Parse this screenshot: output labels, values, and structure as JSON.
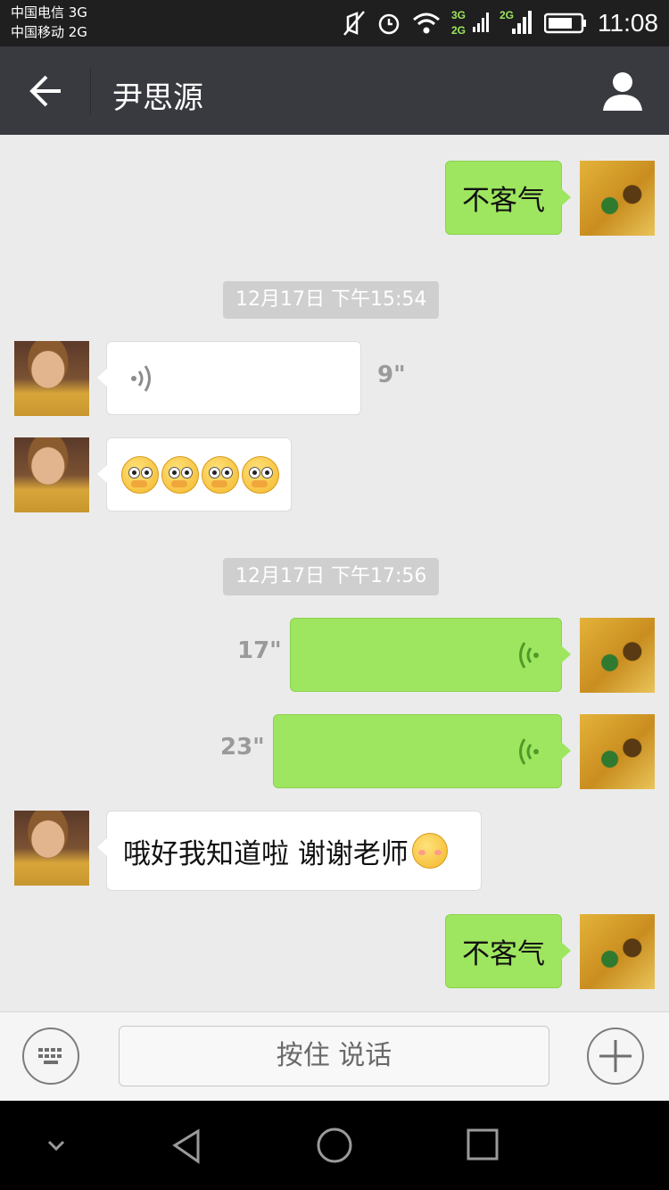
{
  "status_bar": {
    "carrier_1": "中国电信 3G",
    "carrier_2": "中国移动 2G",
    "time": "11:08",
    "net_1": "3G",
    "net_2": "2G",
    "net_3": "2G"
  },
  "header": {
    "title": "尹思源"
  },
  "messages": {
    "m1_text": "不客气",
    "ts1": "12月17日 下午15:54",
    "m2_duration": "9\"",
    "ts2": "12月17日 下午17:56",
    "m4_duration": "17\"",
    "m5_duration": "23\"",
    "m6_text": "哦好我知道啦 谢谢老师",
    "m7_text": "不客气"
  },
  "input_bar": {
    "hold_to_talk": "按住 说话"
  },
  "colors": {
    "outgoing_bubble": "#9ee65f",
    "title_bar": "#393a3f",
    "background": "#ebebeb"
  }
}
